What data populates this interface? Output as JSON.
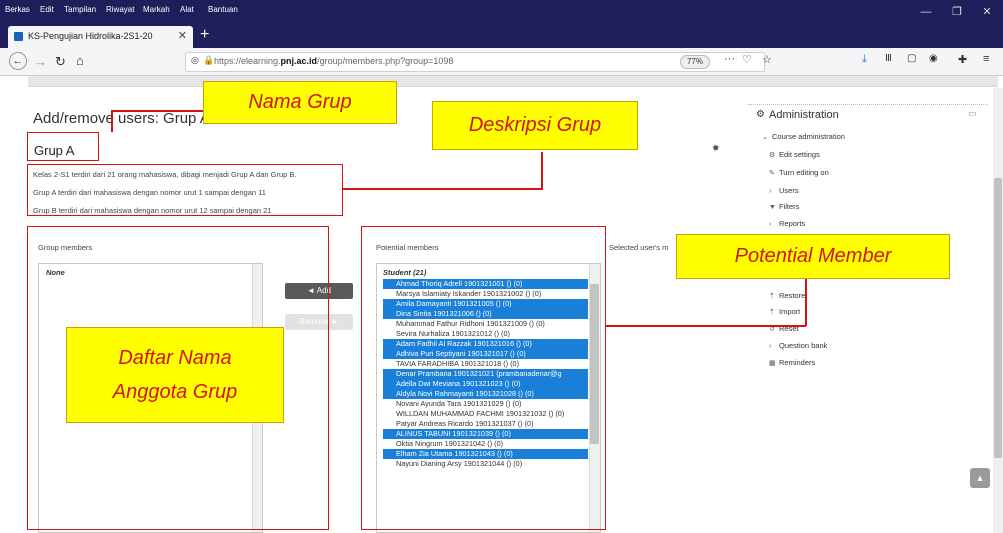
{
  "browser": {
    "menu": [
      "Berkas",
      "Edit",
      "Tampilan",
      "Riwayat",
      "Markah",
      "Alat",
      "Bantuan"
    ],
    "tab_title": "KS-Pengujian Hidrolika-2S1-20",
    "url_prefix": "https://elearning.",
    "url_domain": "pnj.ac.id",
    "url_suffix": "/group/members.php?group=1098",
    "zoom": "77%"
  },
  "page": {
    "title": "Add/remove users: Grup A",
    "group_name": "Grup A",
    "description": [
      "Kelas 2-S1 terdiri dari 21 orang mahasiswa, dibagi menjadi Grup A dan Grup B.",
      "Grup A terdiri dari mahasiswa dengan nomor urut 1 sampai dengan 11",
      "Grup B terdiri dari mahasiswa dengan nomor urut 12 sampai dengan 21"
    ],
    "group_members_label": "Group members",
    "potential_members_label": "Potential members",
    "selected_user_label": "Selected user's m",
    "members_none": "None",
    "add_label": "◄ Add",
    "remove_label": "Remove ►",
    "optgroup_label": "Student (21)",
    "students": [
      {
        "name": "Ahmad Thoriq Adrell 1901321001 () (0)",
        "selected": true
      },
      {
        "name": "Marsya Islamiaty Iskander 1901321002 () (0)",
        "selected": false
      },
      {
        "name": "Amila Damayanti 1901321005 () (0)",
        "selected": true
      },
      {
        "name": "Dina Sintia 1901321006 () (0)",
        "selected": true
      },
      {
        "name": "Muhammad Fathur Ridhoni 1901321009 () (0)",
        "selected": false
      },
      {
        "name": "Sevira Nurhaliza 1901321012 () (0)",
        "selected": false
      },
      {
        "name": "Adam Fadhil Al Razzak 1901321016 () (0)",
        "selected": true
      },
      {
        "name": "Adhiva Puri Septiyani 1901321017 () (0)",
        "selected": true
      },
      {
        "name": "TAVIA FARADHIBA 1901321018 () (0)",
        "selected": false
      },
      {
        "name": "Denar Prambana 1901321021 (prambanadenar@g",
        "selected": true
      },
      {
        "name": "Adella Dwi Meviana 1901321023 () (0)",
        "selected": true
      },
      {
        "name": "Aldyla Novi Rahmayanti 1901321028 () (0)",
        "selected": true
      },
      {
        "name": "Novani Ayunda Tara 1901321029 () (0)",
        "selected": false
      },
      {
        "name": "WILLDAN MUHAMMAD FACHMI 1901321032 () (0)",
        "selected": false
      },
      {
        "name": "Patyar Andreas Ricardo 1901321037 () (0)",
        "selected": false
      },
      {
        "name": "ALINUS TABUNI 1901321039 () (0)",
        "selected": true
      },
      {
        "name": "Oktia Ningrum 1901321042 () (0)",
        "selected": false
      },
      {
        "name": "Elham Zia Utama 1901321043 () (0)",
        "selected": true
      },
      {
        "name": "Nayuni Dianing Arsy 1901321044 () (0)",
        "selected": false
      }
    ]
  },
  "sidebar": {
    "title": "Administration",
    "items": [
      "Course administration",
      "Edit settings",
      "Turn editing on",
      "Users",
      "Filters",
      "Reports",
      "Restore",
      "Import",
      "Reset",
      "Question bank",
      "Reminders"
    ]
  },
  "annotations": {
    "nama_grup": "Nama Grup",
    "deskripsi_grup": "Deskripsi Grup",
    "potential_member": "Potential Member",
    "daftar_nama_1": "Daftar Nama",
    "daftar_nama_2": "Anggota Grup"
  },
  "colors": {
    "annotation_red": "#d51313",
    "callout_yellow": "#ffff00",
    "selection_blue": "#1a7fd9",
    "titlebar": "#1e1e5a"
  }
}
